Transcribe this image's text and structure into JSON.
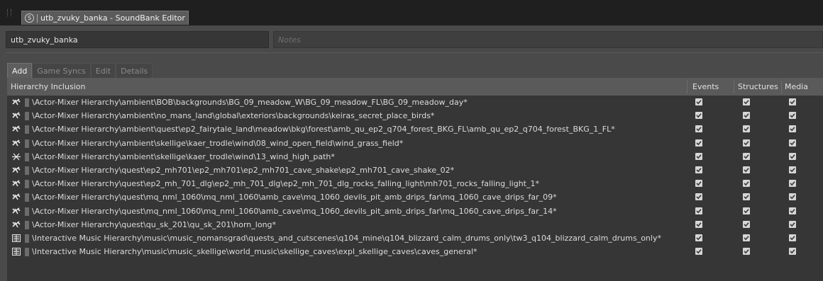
{
  "window": {
    "tab_title": "utb_zvuky_banka - SoundBank Editor",
    "tab_icon": "S"
  },
  "fields": {
    "name_value": "utb_zvuky_banka",
    "notes_placeholder": "Notes"
  },
  "tabs": [
    {
      "label": "Add",
      "active": true
    },
    {
      "label": "Game Syncs",
      "active": false
    },
    {
      "label": "Edit",
      "active": false
    },
    {
      "label": "Details",
      "active": false
    }
  ],
  "table": {
    "columns": {
      "hierarchy": "Hierarchy Inclusion",
      "events": "Events",
      "structures": "Structures",
      "media": "Media"
    },
    "rows": [
      {
        "icon": "random-container-icon",
        "path": "\\Actor-Mixer Hierarchy\\ambient\\BOB\\backgrounds\\BG_09_meadow_W\\BG_09_meadow_FL\\BG_09_meadow_day*",
        "events": true,
        "structures": true,
        "media": true
      },
      {
        "icon": "random-container-icon",
        "path": "\\Actor-Mixer Hierarchy\\ambient\\no_mans_land\\global\\exteriors\\backgrounds\\keiras_secret_place_birds*",
        "events": true,
        "structures": true,
        "media": true
      },
      {
        "icon": "random-container-icon",
        "path": "\\Actor-Mixer Hierarchy\\ambient\\quest\\ep2_fairytale_land\\meadow\\bkg\\forest\\amb_qu_ep2_q704_forest_BKG_FL\\amb_qu_ep2_q704_forest_BKG_1_FL*",
        "events": true,
        "structures": true,
        "media": true
      },
      {
        "icon": "random-container-icon",
        "path": "\\Actor-Mixer Hierarchy\\ambient\\skellige\\kaer_trodle\\wind\\08_wind_open_field\\wind_grass_field*",
        "events": true,
        "structures": true,
        "media": true
      },
      {
        "icon": "blend-container-icon",
        "path": "\\Actor-Mixer Hierarchy\\ambient\\skellige\\kaer_trodle\\wind\\13_wind_high_path*",
        "events": true,
        "structures": true,
        "media": true
      },
      {
        "icon": "random-container-icon",
        "path": "\\Actor-Mixer Hierarchy\\quest\\ep2_mh701\\ep2_mh701\\ep2_mh701_cave_shake\\ep2_mh701_cave_shake_02*",
        "events": true,
        "structures": true,
        "media": true
      },
      {
        "icon": "random-container-icon",
        "path": "\\Actor-Mixer Hierarchy\\quest\\ep2_mh_701_dlg\\ep2_mh_701_dlg\\ep2_mh_701_dlg_rocks_falling_light\\mh701_rocks_falling_light_1*",
        "events": true,
        "structures": true,
        "media": true
      },
      {
        "icon": "random-container-icon",
        "path": "\\Actor-Mixer Hierarchy\\quest\\mq_nml_1060\\mq_nml_1060\\amb_cave\\mq_1060_devils_pit_amb_drips_far\\mq_1060_cave_drips_far_09*",
        "events": true,
        "structures": true,
        "media": true
      },
      {
        "icon": "random-container-icon",
        "path": "\\Actor-Mixer Hierarchy\\quest\\mq_nml_1060\\mq_nml_1060\\amb_cave\\mq_1060_devils_pit_amb_drips_far\\mq_1060_cave_drips_far_14*",
        "events": true,
        "structures": true,
        "media": true
      },
      {
        "icon": "random-container-icon",
        "path": "\\Actor-Mixer Hierarchy\\quest\\qu_sk_201\\qu_sk_201\\horn_long*",
        "events": true,
        "structures": true,
        "media": true
      },
      {
        "icon": "music-playlist-icon",
        "path": "\\Interactive Music Hierarchy\\music\\music_nomansgrad\\quests_and_cutscenes\\q104_mine\\q104_blizzard_calm_drums_only\\tw3_q104_blizzard_calm_drums_only*",
        "events": true,
        "structures": true,
        "media": true
      },
      {
        "icon": "music-playlist-icon",
        "path": "\\Interactive Music Hierarchy\\music\\music_skellige\\world_music\\skellige_caves\\expl_skellige_caves\\caves_general*",
        "events": true,
        "structures": true,
        "media": true
      }
    ]
  }
}
